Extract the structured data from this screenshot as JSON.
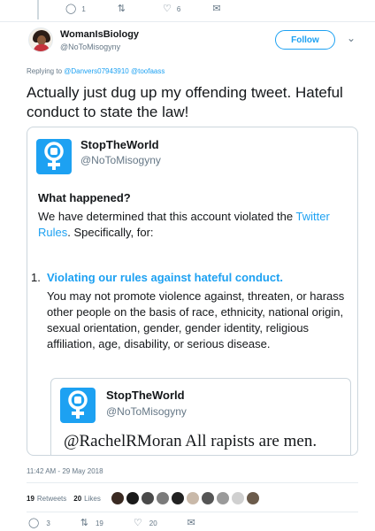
{
  "top_actions": {
    "reply_count": "1",
    "retweet_count": "",
    "like_count": "6"
  },
  "author": {
    "name": "WomanIsBiology",
    "handle": "@NoToMisogyny"
  },
  "follow_label": "Follow",
  "replying": {
    "prefix": "Replying to ",
    "mention1": "@Danvers07943910",
    "mention2": "@toofaass"
  },
  "tweet_text": "Actually just dug up my offending tweet. Hateful conduct to state the law!",
  "quoted": {
    "name": "StopTheWorld",
    "handle": "@NoToMisogyny",
    "heading": "What happened?",
    "body_pre": "We have determined that this account violated the ",
    "rules_link": "Twitter Rules",
    "body_post": ". Specifically, for:",
    "rule_number": "1.",
    "rule_title": "Violating our rules against hateful conduct.",
    "rule_text": "You may not promote violence against, threaten, or harass other people on the basis of race, ethnicity, national origin, sexual orientation, gender, gender identity, religious affiliation, age, disability, or serious disease.",
    "inner": {
      "name": "StopTheWorld",
      "handle": "@NoToMisogyny",
      "text": "@RachelRMoran All rapists are men.",
      "text_cut": "... ... ... ... ... ... ..."
    }
  },
  "timestamp": "11:42 AM - 29 May 2018",
  "stats": {
    "retweets_count": "19",
    "retweets_label": "Retweets",
    "likes_count": "20",
    "likes_label": "Likes",
    "liker_colors": [
      "#3a2a22",
      "#1a1a1a",
      "#4a4a4a",
      "#7b7b7b",
      "#222222",
      "#c9b9a9",
      "#555555",
      "#9a9a9a",
      "#d0d0d0",
      "#6b5b4b"
    ]
  },
  "bottom_actions": {
    "reply_count": "3",
    "retweet_count": "19",
    "like_count": "20"
  },
  "colors": {
    "accent": "#1da1f2",
    "text": "#14171a",
    "muted": "#657786"
  }
}
